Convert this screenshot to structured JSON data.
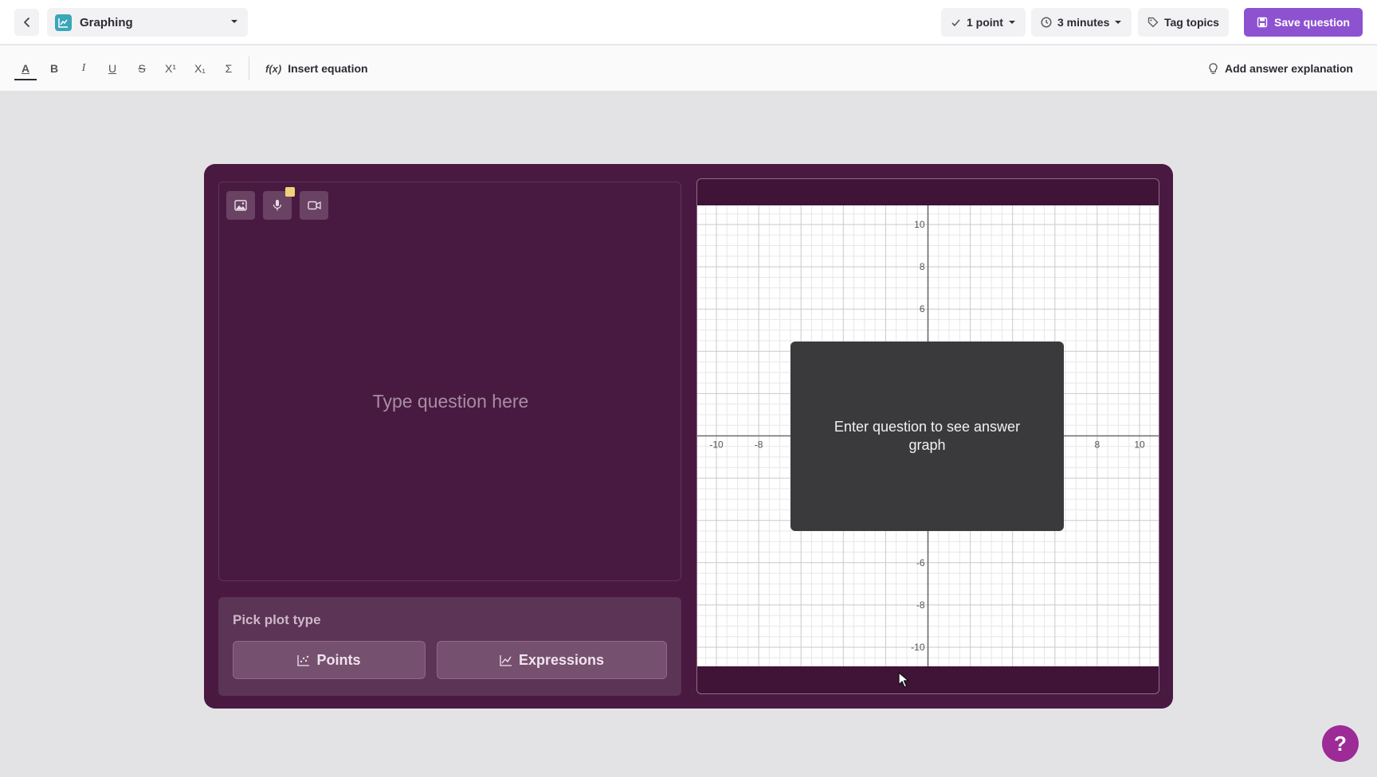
{
  "header": {
    "question_type": "Graphing",
    "points": "1 point",
    "time": "3 minutes",
    "tag_topics": "Tag topics",
    "save_question": "Save question"
  },
  "toolbar": {
    "items": [
      "A",
      "B",
      "I",
      "U",
      "S",
      "X¹",
      "X₁",
      "Σ"
    ],
    "insert_equation": "Insert equation",
    "insert_equation_icon": "f(x)",
    "add_answer_explanation": "Add answer explanation"
  },
  "question": {
    "placeholder": "Type question here",
    "media_buttons": [
      "image-icon",
      "microphone-icon",
      "video-icon"
    ]
  },
  "plot": {
    "title": "Pick plot type",
    "options": [
      "Points",
      "Expressions"
    ]
  },
  "graph": {
    "overlay_text": "Enter question to see answer graph",
    "x_ticks": [
      "-10",
      "-8",
      "8",
      "10"
    ],
    "y_ticks": [
      "10",
      "8",
      "6",
      "-6",
      "-8",
      "-10"
    ],
    "x_range": [
      -10,
      10
    ],
    "y_range": [
      -10,
      10
    ],
    "grid": true
  },
  "help": {
    "label": "?"
  },
  "colors": {
    "card": "#4a1941",
    "accent": "#8d52cf",
    "help": "#9c2b97"
  }
}
